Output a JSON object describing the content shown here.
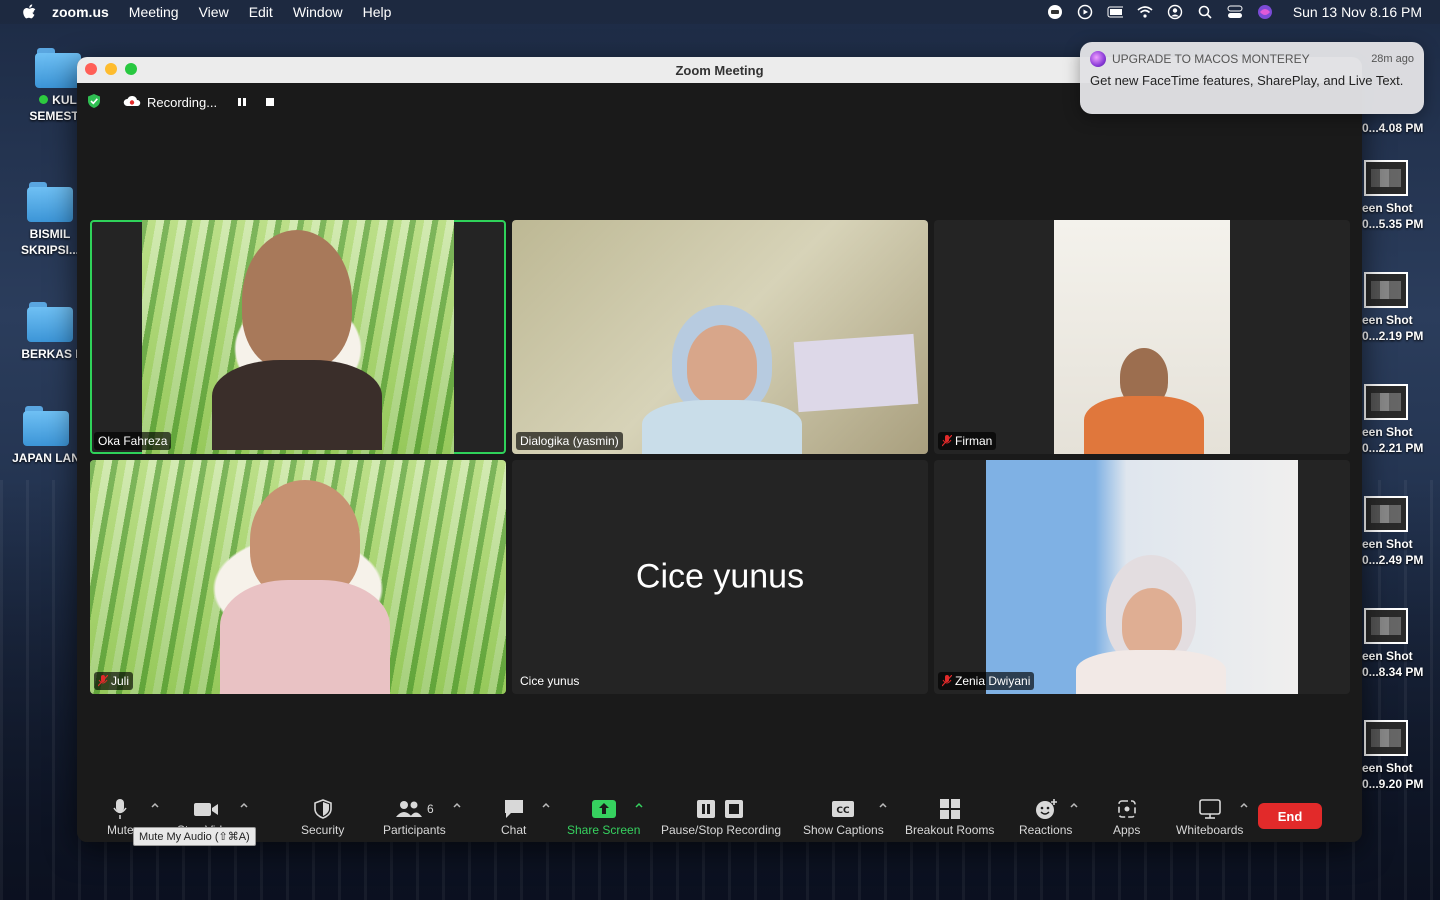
{
  "menubar": {
    "app": "zoom.us",
    "items": [
      "Meeting",
      "View",
      "Edit",
      "Window",
      "Help"
    ],
    "clock": "Sun 13 Nov  8.16 PM"
  },
  "desktop": {
    "icons": [
      {
        "label": "KUL SEMESTE",
        "has_dot": true
      },
      {
        "label": "BISMIL SKRIPSI...",
        "has_dot": false
      },
      {
        "label": "BERKAS I",
        "has_dot": false
      },
      {
        "label": "JAPAN LAN",
        "has_dot": false
      }
    ],
    "screenshots": [
      {
        "label1": "",
        "label2": "0...4.08 PM"
      },
      {
        "label1": "een Shot",
        "label2": "0...5.35 PM"
      },
      {
        "label1": "een Shot",
        "label2": "0...2.19 PM"
      },
      {
        "label1": "een Shot",
        "label2": "0...2.21 PM"
      },
      {
        "label1": "een Shot",
        "label2": "0...2.49 PM"
      },
      {
        "label1": "een Shot",
        "label2": "0...8.34 PM"
      },
      {
        "label1": "een Shot",
        "label2": "0...9.20 PM"
      }
    ]
  },
  "window": {
    "title": "Zoom Meeting",
    "recording_label": "Recording..."
  },
  "participants": [
    {
      "name": "Oka Fahreza",
      "muted": false,
      "active": true
    },
    {
      "name": "Dialogika (yasmin)",
      "muted": false,
      "active": false
    },
    {
      "name": "Firman",
      "muted": true,
      "active": false
    },
    {
      "name": "Juli",
      "muted": true,
      "active": false
    },
    {
      "name": "Cice yunus",
      "muted": false,
      "active": false,
      "video_off_label": "Cice yunus"
    },
    {
      "name": "Zenia Dwiyani",
      "muted": true,
      "active": false
    }
  ],
  "toolbar": {
    "mute": "Mute",
    "video": "Stop Video",
    "security": "Security",
    "participants": "Participants",
    "participant_count": "6",
    "chat": "Chat",
    "share": "Share Screen",
    "recording": "Pause/Stop Recording",
    "captions": "Show Captions",
    "breakout": "Breakout Rooms",
    "reactions": "Reactions",
    "apps": "Apps",
    "whiteboards": "Whiteboards",
    "end": "End",
    "tooltip": "Mute My Audio (⇧⌘A)"
  },
  "notification": {
    "title": "UPGRADE TO MACOS MONTEREY",
    "time": "28m ago",
    "message": "Get new FaceTime features, SharePlay, and Live Text."
  }
}
